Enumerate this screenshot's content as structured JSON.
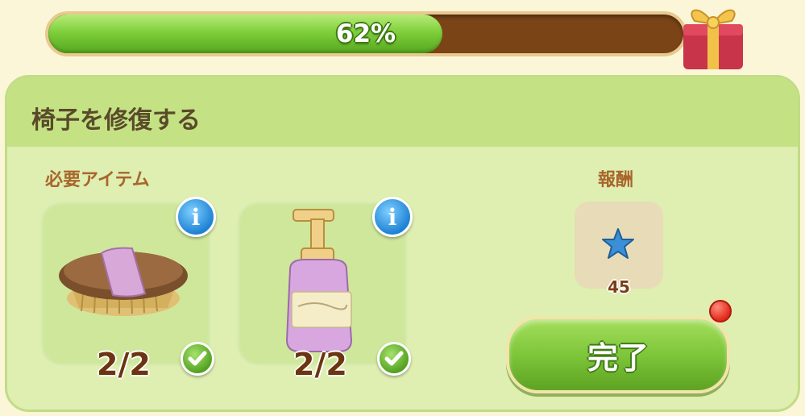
{
  "progress": {
    "percent": 62,
    "label": "62%"
  },
  "panel": {
    "title": "椅子を修復する"
  },
  "required": {
    "label": "必要アイテム",
    "items": [
      {
        "name": "brush",
        "count": "2/2",
        "complete": true
      },
      {
        "name": "soap",
        "count": "2/2",
        "complete": true
      }
    ]
  },
  "reward": {
    "label": "報酬",
    "amount": "45",
    "icon": "blue-star-icon"
  },
  "complete_button": {
    "label": "完了"
  },
  "colors": {
    "accent_green": "#7ec63a",
    "panel_bg": "#dfeeb1",
    "progress_track": "#7a4417"
  }
}
